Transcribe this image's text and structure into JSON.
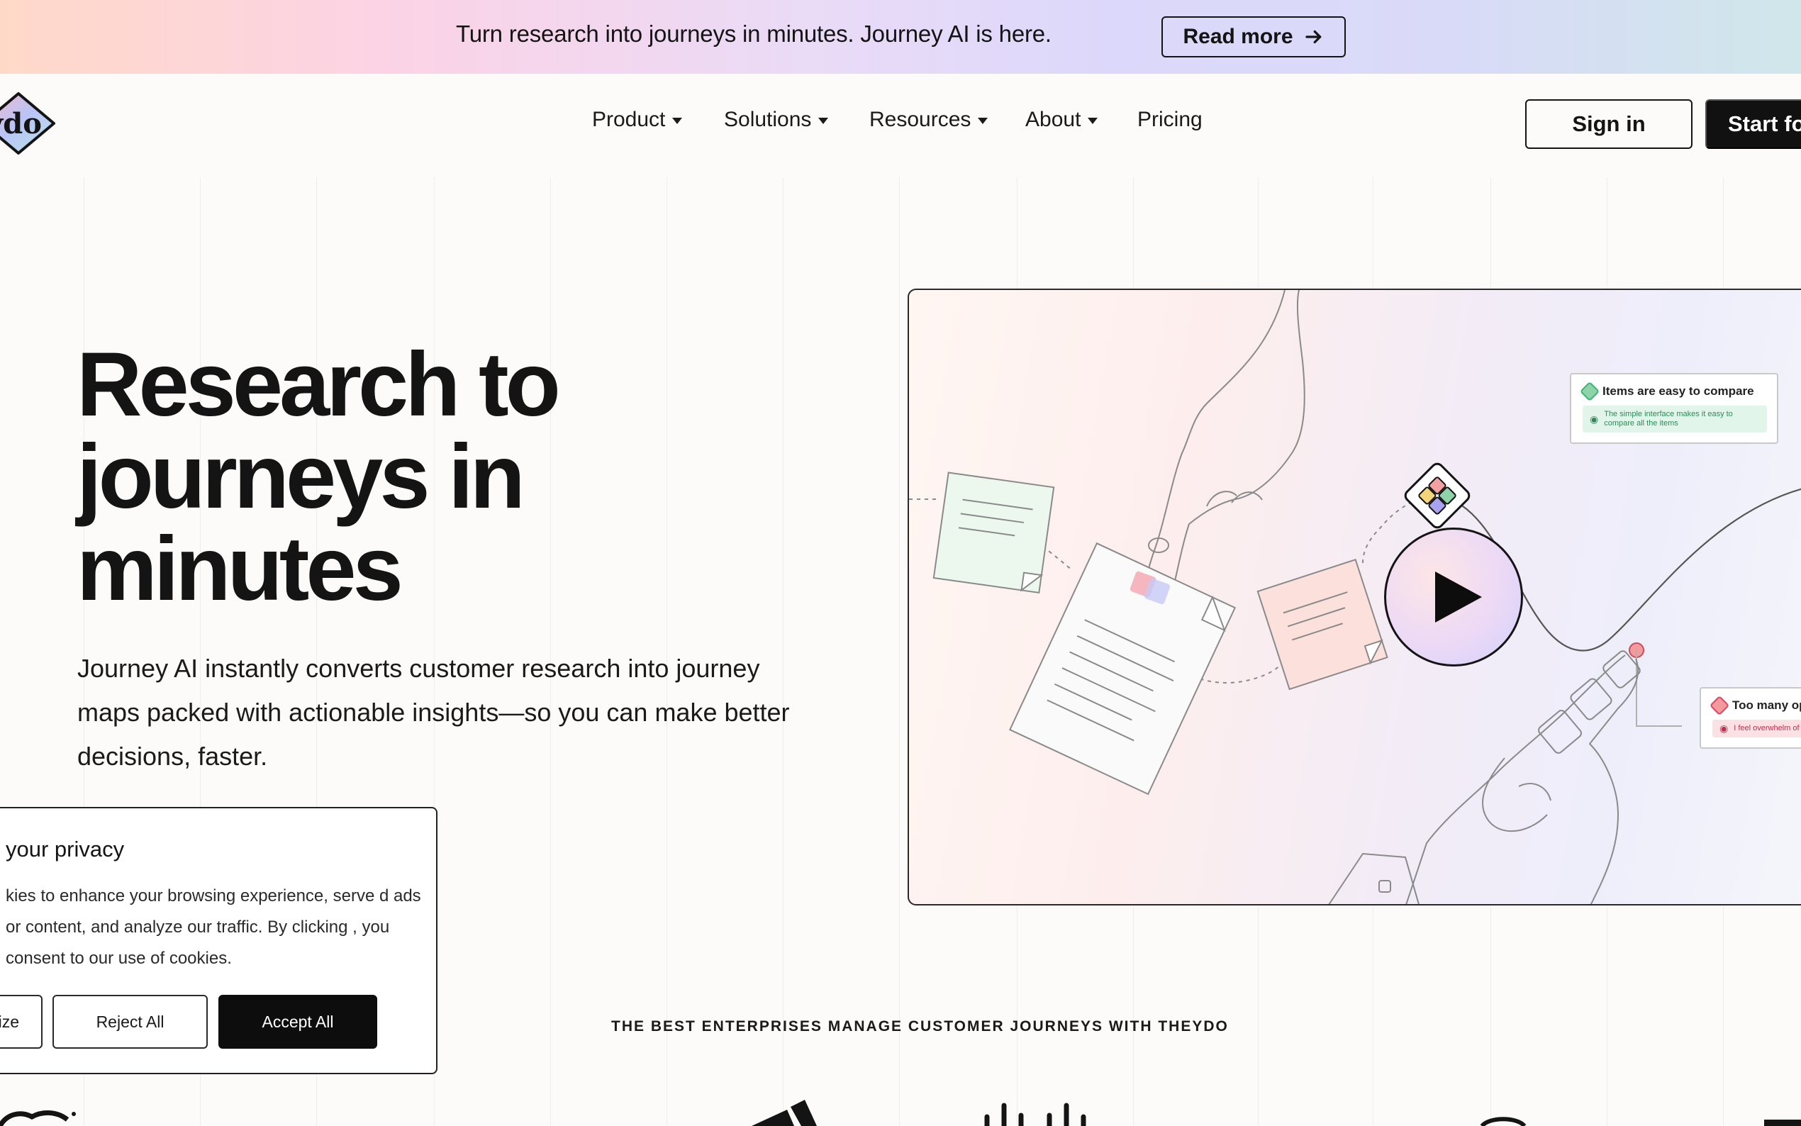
{
  "banner": {
    "text": "Turn research into journeys in minutes. Journey AI is here.",
    "button_label": "Read more",
    "button_icon": "arrow-right-icon"
  },
  "header": {
    "logo_text": "ydo",
    "nav": [
      {
        "label": "Product",
        "has_dropdown": true
      },
      {
        "label": "Solutions",
        "has_dropdown": true
      },
      {
        "label": "Resources",
        "has_dropdown": true
      },
      {
        "label": "About",
        "has_dropdown": true
      },
      {
        "label": "Pricing",
        "has_dropdown": false
      }
    ],
    "signin_label": "Sign in",
    "start_label": "Start fo"
  },
  "hero": {
    "title_lines": [
      "Research to",
      "journeys in",
      "minutes"
    ],
    "subtitle": "Journey AI instantly converts customer research into journey maps packed with actionable insights—so you can make better decisions, faster.",
    "video": {
      "play_icon": "play-icon",
      "card_good": {
        "title": "Items are easy to compare",
        "note": "The simple interface makes it easy to compare all the items",
        "color": "#3fb574"
      },
      "card_bad": {
        "title": "Too many op",
        "note": "I feel overwhelm of options avail",
        "color": "#e0485f"
      }
    }
  },
  "trust": {
    "text": "THE BEST ENTERPRISES MANAGE CUSTOMER JOURNEYS WITH THEYDO"
  },
  "cookie": {
    "title": "your privacy",
    "body": "kies to enhance your browsing experience, serve d ads or content, and analyze our traffic. By clicking , you consent to our use of cookies.",
    "customize_label": "nize",
    "reject_label": "Reject All",
    "accept_label": "Accept All"
  },
  "colors": {
    "primary": "#141414",
    "background": "#fcfbf9",
    "positive": "#3fb574",
    "negative": "#e0485f"
  }
}
